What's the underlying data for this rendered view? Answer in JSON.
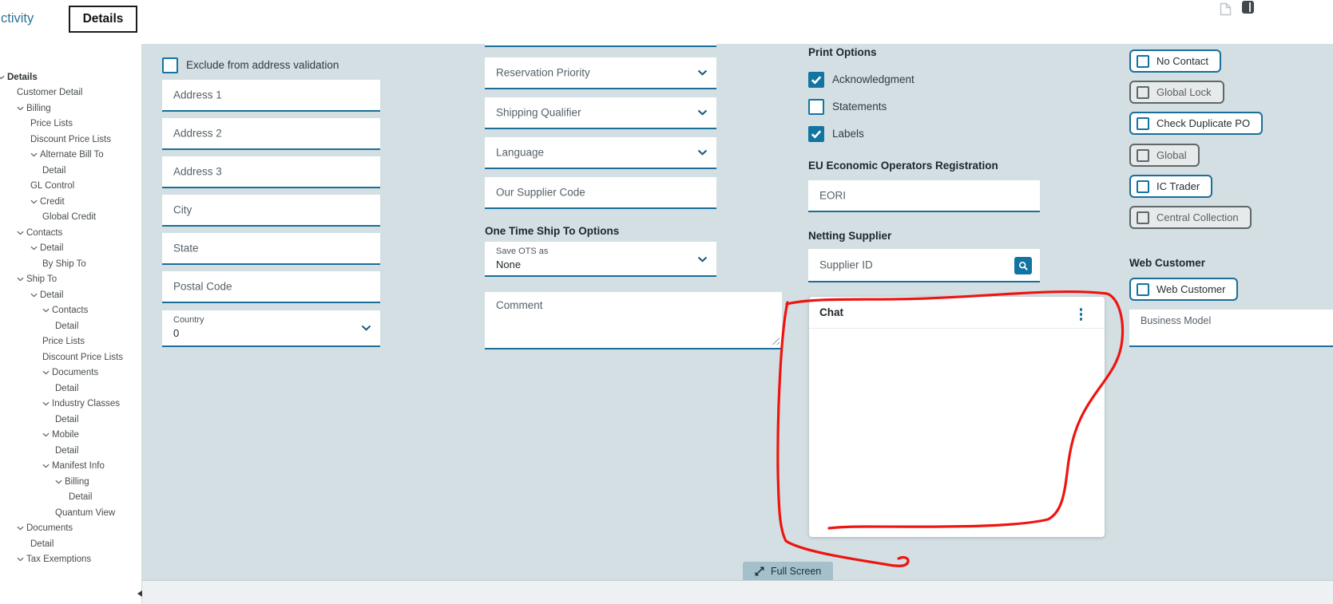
{
  "tabs": {
    "partial_label": "ctivity",
    "active_label": "Details"
  },
  "sidebar": {
    "items": [
      {
        "label": "Details",
        "level": 0,
        "chevron": true,
        "bold": true
      },
      {
        "label": "Customer Detail",
        "level": 1,
        "chevron": false,
        "bold": false
      },
      {
        "label": "Billing",
        "level": 1,
        "chevron": true,
        "bold": false
      },
      {
        "label": "Price Lists",
        "level": 2,
        "chevron": false,
        "bold": false
      },
      {
        "label": "Discount Price Lists",
        "level": 2,
        "chevron": false,
        "bold": false
      },
      {
        "label": "Alternate Bill To",
        "level": 2,
        "chevron": true,
        "bold": false
      },
      {
        "label": "Detail",
        "level": 3,
        "chevron": false,
        "bold": false
      },
      {
        "label": "GL Control",
        "level": 2,
        "chevron": false,
        "bold": false
      },
      {
        "label": "Credit",
        "level": 2,
        "chevron": true,
        "bold": false
      },
      {
        "label": "Global Credit",
        "level": 3,
        "chevron": false,
        "bold": false
      },
      {
        "label": "Contacts",
        "level": 1,
        "chevron": true,
        "bold": false
      },
      {
        "label": "Detail",
        "level": 2,
        "chevron": true,
        "bold": false
      },
      {
        "label": "By Ship To",
        "level": 3,
        "chevron": false,
        "bold": false
      },
      {
        "label": "Ship To",
        "level": 1,
        "chevron": true,
        "bold": false
      },
      {
        "label": "Detail",
        "level": 2,
        "chevron": true,
        "bold": false
      },
      {
        "label": "Contacts",
        "level": 3,
        "chevron": true,
        "bold": false
      },
      {
        "label": "Detail",
        "level": 4,
        "chevron": false,
        "bold": false
      },
      {
        "label": "Price Lists",
        "level": 3,
        "chevron": false,
        "bold": false
      },
      {
        "label": "Discount Price Lists",
        "level": 3,
        "chevron": false,
        "bold": false
      },
      {
        "label": "Documents",
        "level": 3,
        "chevron": true,
        "bold": false
      },
      {
        "label": "Detail",
        "level": 4,
        "chevron": false,
        "bold": false
      },
      {
        "label": "Industry Classes",
        "level": 3,
        "chevron": true,
        "bold": false
      },
      {
        "label": "Detail",
        "level": 4,
        "chevron": false,
        "bold": false
      },
      {
        "label": "Mobile",
        "level": 3,
        "chevron": true,
        "bold": false
      },
      {
        "label": "Detail",
        "level": 4,
        "chevron": false,
        "bold": false
      },
      {
        "label": "Manifest Info",
        "level": 3,
        "chevron": true,
        "bold": false
      },
      {
        "label": "Billing",
        "level": 4,
        "chevron": true,
        "bold": false
      },
      {
        "label": "Detail",
        "level": 5,
        "chevron": false,
        "bold": false
      },
      {
        "label": "Quantum View",
        "level": 4,
        "chevron": false,
        "bold": false
      },
      {
        "label": "Documents",
        "level": 1,
        "chevron": true,
        "bold": false
      },
      {
        "label": "Detail",
        "level": 2,
        "chevron": false,
        "bold": false
      },
      {
        "label": "Tax Exemptions",
        "level": 1,
        "chevron": true,
        "bold": false
      }
    ]
  },
  "address_column": {
    "exclude_checkbox": "Exclude from address validation",
    "fields": [
      "Address 1",
      "Address 2",
      "Address 3",
      "City",
      "State",
      "Postal Code"
    ],
    "country": {
      "label": "Country",
      "value": "0"
    }
  },
  "middle_column": {
    "selects": [
      "Reservation Priority",
      "Shipping Qualifier",
      "Language"
    ],
    "supplier_code": "Our Supplier Code",
    "ots": {
      "header": "One Time Ship To Options",
      "save_label": "Save OTS as",
      "save_value": "None"
    },
    "comment": "Comment"
  },
  "print_options": {
    "header": "Print Options",
    "items": [
      {
        "label": "Acknowledgment",
        "checked": true
      },
      {
        "label": "Statements",
        "checked": false
      },
      {
        "label": "Labels",
        "checked": true
      }
    ]
  },
  "eu": {
    "header": "EU Economic Operators Registration",
    "placeholder": "EORI"
  },
  "netting": {
    "header": "Netting Supplier",
    "placeholder": "Supplier ID"
  },
  "chat": {
    "title": "Chat"
  },
  "flags": [
    {
      "label": "No Contact",
      "enabled": true
    },
    {
      "label": "Global Lock",
      "enabled": false
    },
    {
      "label": "Check Duplicate PO",
      "enabled": true
    },
    {
      "label": "Global",
      "enabled": false
    },
    {
      "label": "IC Trader",
      "enabled": true
    },
    {
      "label": "Central Collection",
      "enabled": false
    }
  ],
  "web_customer": {
    "header": "Web Customer",
    "checkbox": "Web Customer",
    "business_model": "Business Model"
  },
  "footer": {
    "fullscreen": "Full Screen"
  },
  "icons": [
    "document-icon",
    "panel-toggle-icon",
    "tree-chevron-icon",
    "chevron-down-icon",
    "search-icon",
    "kebab-menu-icon",
    "expand-icon",
    "resize-handle",
    "scroll-arrow-icon"
  ],
  "colors": {
    "panel_bg": "#d3dfe3",
    "accent": "#1274a0",
    "field_border": "#1a6e99",
    "tab_blue": "#2e7196",
    "sidebar_text": "#474d4f",
    "placeholder": "#566167",
    "header_text": "#1d262b",
    "disabled_border": "#5f676a",
    "disabled_bg": "#e7eaea",
    "disabled_text": "#5a6164",
    "red": "#ee1410",
    "btn_bg": "#a4c0cb",
    "strip_bg": "#edf1f2"
  }
}
